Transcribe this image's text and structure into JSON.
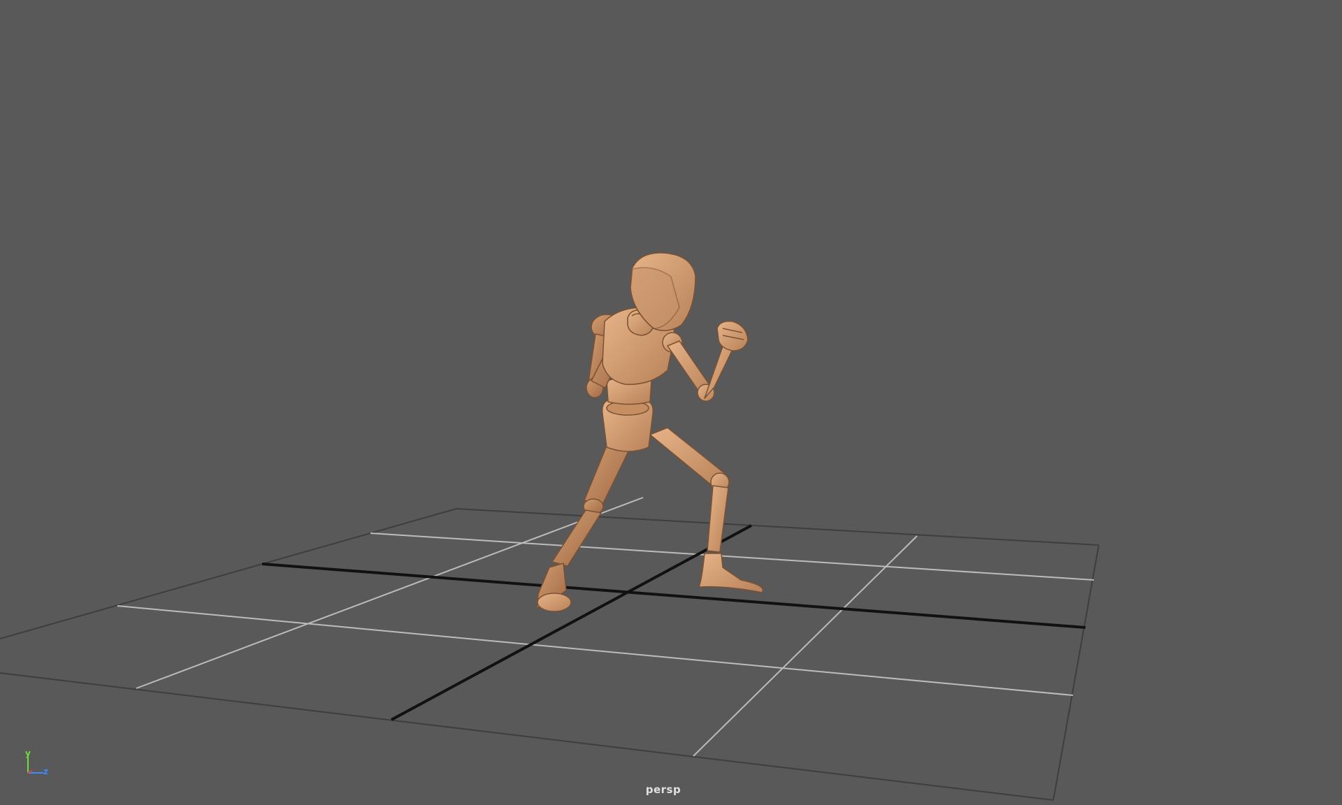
{
  "viewport": {
    "camera_name": "persp",
    "background_color": "#595959"
  },
  "axis_gizmo": {
    "y_label": "y",
    "z_label": "z",
    "x_color": "#e03c3c",
    "y_color": "#6edc3c",
    "z_color": "#3c8cff"
  },
  "scene": {
    "grid_line_color": "#bdbdbd",
    "grid_axis_color": "#111111",
    "model_color": "#d8a276",
    "model_pose": "boxing stance"
  }
}
